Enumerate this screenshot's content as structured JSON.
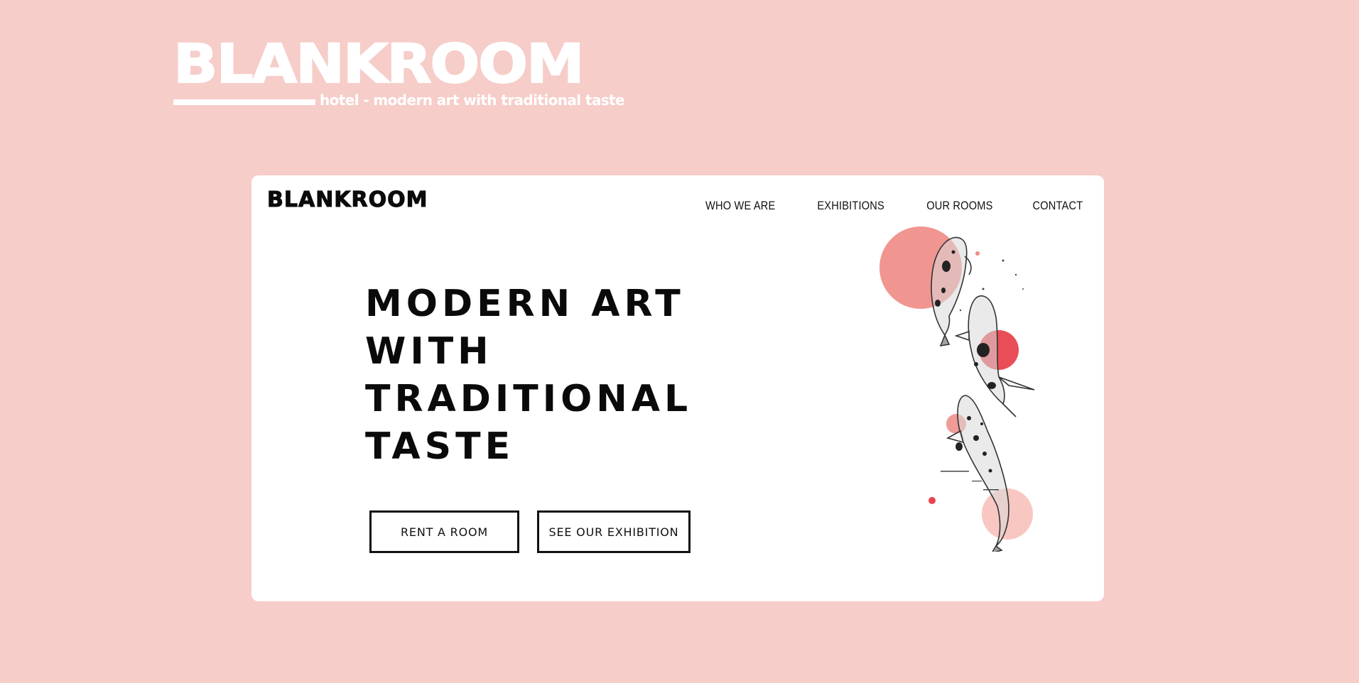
{
  "brand": {
    "wordmark": "BLANKROOM",
    "tagline": "hotel - modern art with traditional taste"
  },
  "card": {
    "logo": "BLANKROOM",
    "nav": [
      {
        "label": "WHO WE ARE"
      },
      {
        "label": "EXHIBITIONS"
      },
      {
        "label": "OUR ROOMS"
      },
      {
        "label": "CONTACT"
      }
    ],
    "headline": [
      "MODERN ART",
      "WITH",
      "TRADITIONAL",
      "TASTE"
    ],
    "buttons": {
      "rent": "RENT A ROOM",
      "exhibition": "SEE OUR EXHIBITION"
    }
  },
  "colors": {
    "page_background": "#f6cdc9",
    "card_background": "#ffffff",
    "accent_coral": "#ef8a84",
    "accent_red": "#e8444f",
    "accent_light": "#f8c7c2",
    "ink": "#111111"
  },
  "icons": {
    "illustration": "koi-fish-illustration"
  }
}
